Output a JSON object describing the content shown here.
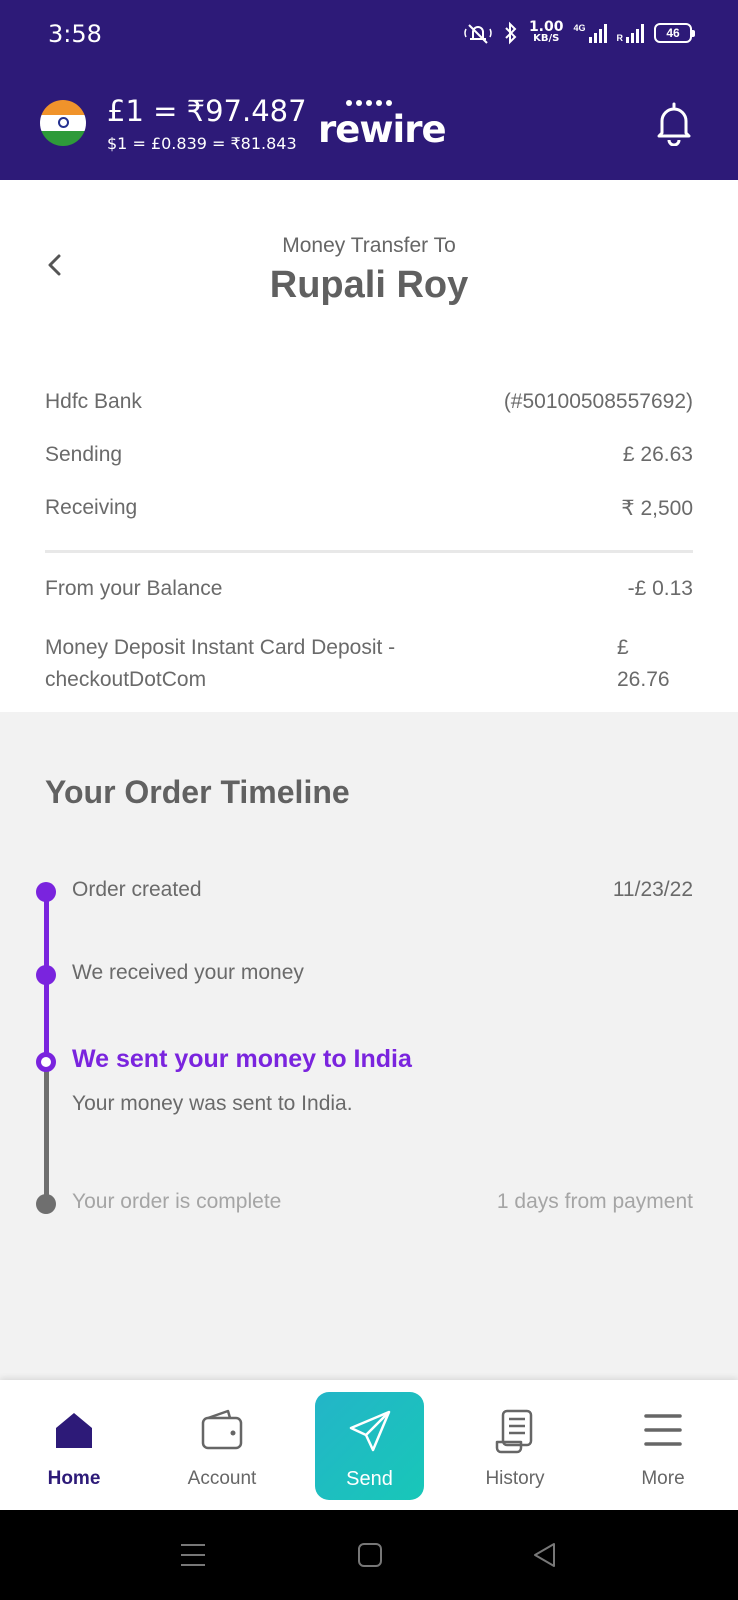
{
  "status_bar": {
    "time": "3:58",
    "net_speed_value": "1.00",
    "net_speed_unit": "KB/S",
    "network_label": "4G",
    "roaming_label": "R",
    "battery": "46"
  },
  "header": {
    "rate_main": "£1 = ₹97.487",
    "rate_sub": "$1 = £0.839 = ₹81.843",
    "brand": "rewire",
    "flag_icon": "india-flag-icon",
    "bell_icon": "bell-icon"
  },
  "title": {
    "label": "Money Transfer To",
    "recipient": "Rupali Roy"
  },
  "details": {
    "bank_label": "Hdfc Bank",
    "bank_account": "(#50100508557692)",
    "sending_label": "Sending",
    "sending_value": "£ 26.63",
    "receiving_label": "Receiving",
    "receiving_value": "₹ 2,500",
    "balance_label": "From your Balance",
    "balance_value": "-£ 0.13",
    "deposit_label": "Money Deposit Instant Card Deposit - checkoutDotCom",
    "deposit_currency": "£",
    "deposit_amount": "26.76"
  },
  "timeline": {
    "title": "Your Order Timeline",
    "steps": [
      {
        "label": "Order created",
        "right": "11/23/22",
        "state": "done"
      },
      {
        "label": "We received your money",
        "right": "",
        "state": "done"
      },
      {
        "label": "We sent your money to India",
        "detail": "Your money was sent to India.",
        "state": "current"
      },
      {
        "label": "Your order is complete",
        "right": "1 days from payment",
        "state": "pending"
      }
    ],
    "colors": {
      "done": "#7a24de",
      "pending": "#6f6f6f"
    }
  },
  "bottom_nav": {
    "items": [
      {
        "label": "Home",
        "icon": "home-icon",
        "active": true
      },
      {
        "label": "Account",
        "icon": "wallet-icon",
        "active": false
      },
      {
        "label": "Send",
        "icon": "paper-plane-icon",
        "active": false
      },
      {
        "label": "History",
        "icon": "receipt-icon",
        "active": false
      },
      {
        "label": "More",
        "icon": "menu-icon",
        "active": false
      }
    ]
  },
  "colors": {
    "brand_purple": "#2d1a78",
    "accent_purple": "#7a24de",
    "send_teal": "#1ec0c0"
  }
}
